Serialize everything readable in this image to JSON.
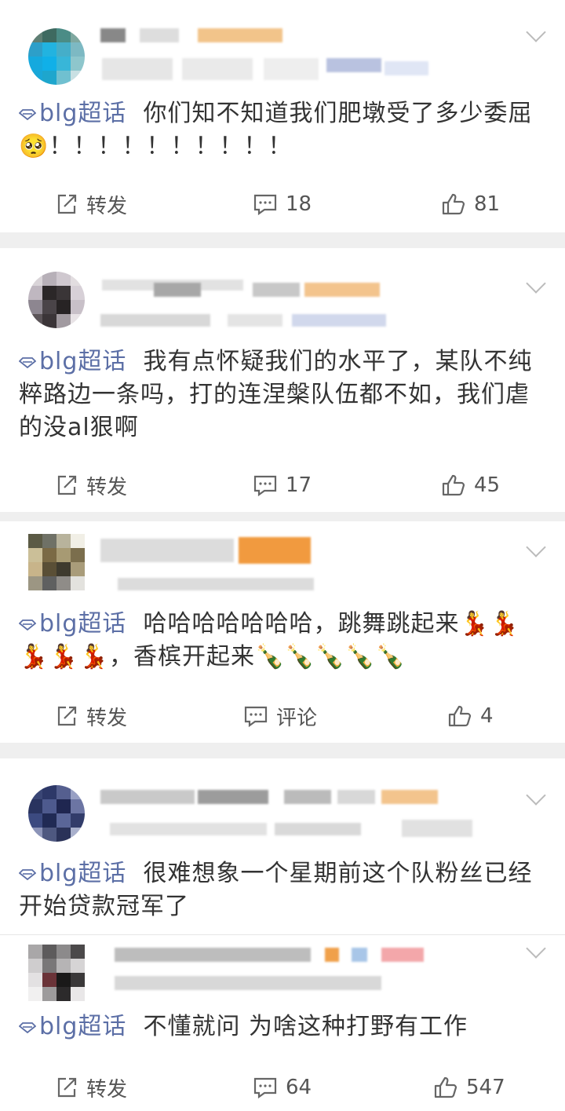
{
  "topic_label": "blg超话",
  "actions": {
    "repost_label": "转发",
    "comment_label": "评论"
  },
  "posts": [
    {
      "text": "你们知不知道我们肥墩受了多少委屈",
      "text_line2": "🥺！！！！！！！！！！",
      "comment_count": "18",
      "like_count": "81"
    },
    {
      "text": "我有点怀疑我们的水平了，某队不纯粹路边一条吗，打的连涅槃队伍都不如，我们虐的没al狠啊",
      "comment_count": "17",
      "like_count": "45"
    },
    {
      "text": "哈哈哈哈哈哈哈，跳舞跳起来💃💃💃💃💃，香槟开起来🍾🍾🍾🍾🍾",
      "like_count": "4"
    },
    {
      "text": "很难想象一个星期前这个队粉丝已经开始贷款冠军了"
    },
    {
      "text": "不懂就问 为啥这种打野有工作",
      "comment_count": "64",
      "like_count": "547"
    }
  ]
}
